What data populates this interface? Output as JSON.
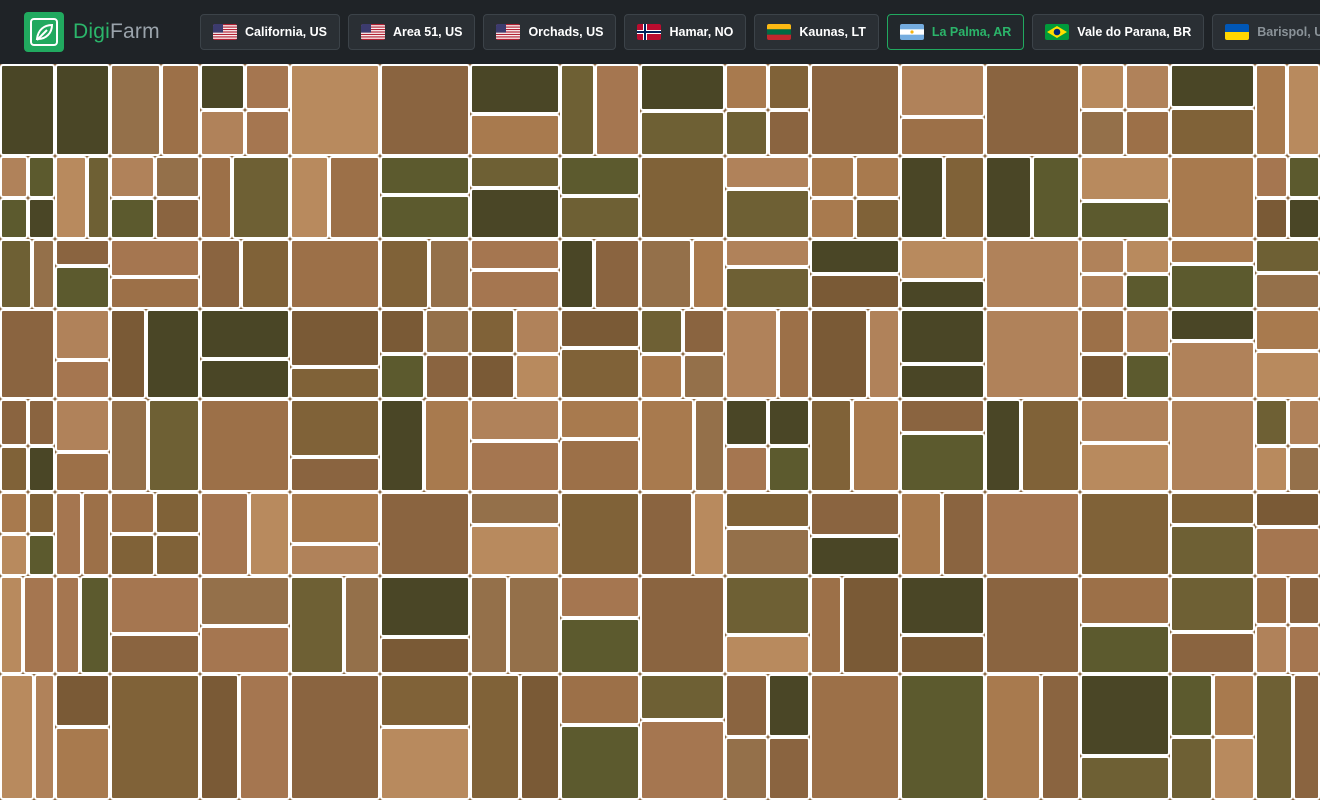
{
  "brand": {
    "part1": "Digi",
    "part2": "Farm",
    "logo_icon": "leaf-icon",
    "accent": "#21a95f"
  },
  "locations": [
    {
      "label": "California, US",
      "flag": "us",
      "active": false
    },
    {
      "label": "Area 51, US",
      "flag": "us",
      "active": false
    },
    {
      "label": "Orchads, US",
      "flag": "us",
      "active": false
    },
    {
      "label": "Hamar, NO",
      "flag": "no",
      "active": false
    },
    {
      "label": "Kaunas, LT",
      "flag": "lt",
      "active": false
    },
    {
      "label": "La Palma, AR",
      "flag": "ar",
      "active": true
    },
    {
      "label": "Vale do Parana, BR",
      "flag": "br",
      "active": false
    },
    {
      "label": "Barispol, UA",
      "flag": "ua",
      "active": false
    }
  ],
  "map": {
    "view": "satellite field boundaries",
    "boundary_color": "#ffffff",
    "field_colors": [
      "#9c7048",
      "#a87a4e",
      "#8a6440",
      "#b0825a",
      "#7a5a36",
      "#6e6034",
      "#5c5a2e",
      "#94704a",
      "#a57650",
      "#4a4626",
      "#806238",
      "#b88a5e"
    ]
  }
}
